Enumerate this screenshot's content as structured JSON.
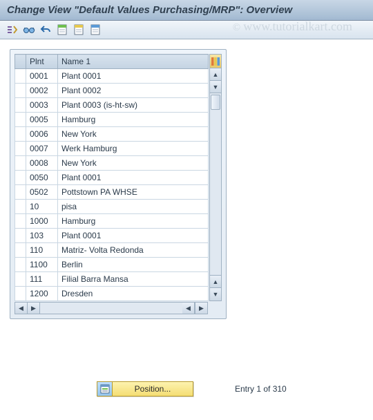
{
  "title": "Change View \"Default Values Purchasing/MRP\": Overview",
  "watermark": "www.tutorialkart.com",
  "toolbar_icons": [
    "toggle-icon",
    "glasses-icon",
    "undo-icon",
    "sheet-green-icon",
    "sheet-yellow-icon",
    "sheet-blue-icon"
  ],
  "columns": {
    "plnt": "Plnt",
    "name": "Name 1"
  },
  "rows": [
    {
      "plnt": "0001",
      "name": "Plant 0001"
    },
    {
      "plnt": "0002",
      "name": "Plant 0002"
    },
    {
      "plnt": "0003",
      "name": "Plant 0003 (is-ht-sw)"
    },
    {
      "plnt": "0005",
      "name": "Hamburg"
    },
    {
      "plnt": "0006",
      "name": "New York"
    },
    {
      "plnt": "0007",
      "name": "Werk Hamburg"
    },
    {
      "plnt": "0008",
      "name": "New York"
    },
    {
      "plnt": "0050",
      "name": "Plant 0001"
    },
    {
      "plnt": "0502",
      "name": "Pottstown PA WHSE"
    },
    {
      "plnt": "10",
      "name": "pisa"
    },
    {
      "plnt": "1000",
      "name": "Hamburg"
    },
    {
      "plnt": "103",
      "name": "Plant 0001"
    },
    {
      "plnt": "110",
      "name": "Matriz- Volta Redonda"
    },
    {
      "plnt": "1100",
      "name": "Berlin"
    },
    {
      "plnt": "111",
      "name": "Filial Barra Mansa"
    },
    {
      "plnt": "1200",
      "name": "Dresden"
    }
  ],
  "position_button": "Position...",
  "entry_status": "Entry 1 of 310"
}
